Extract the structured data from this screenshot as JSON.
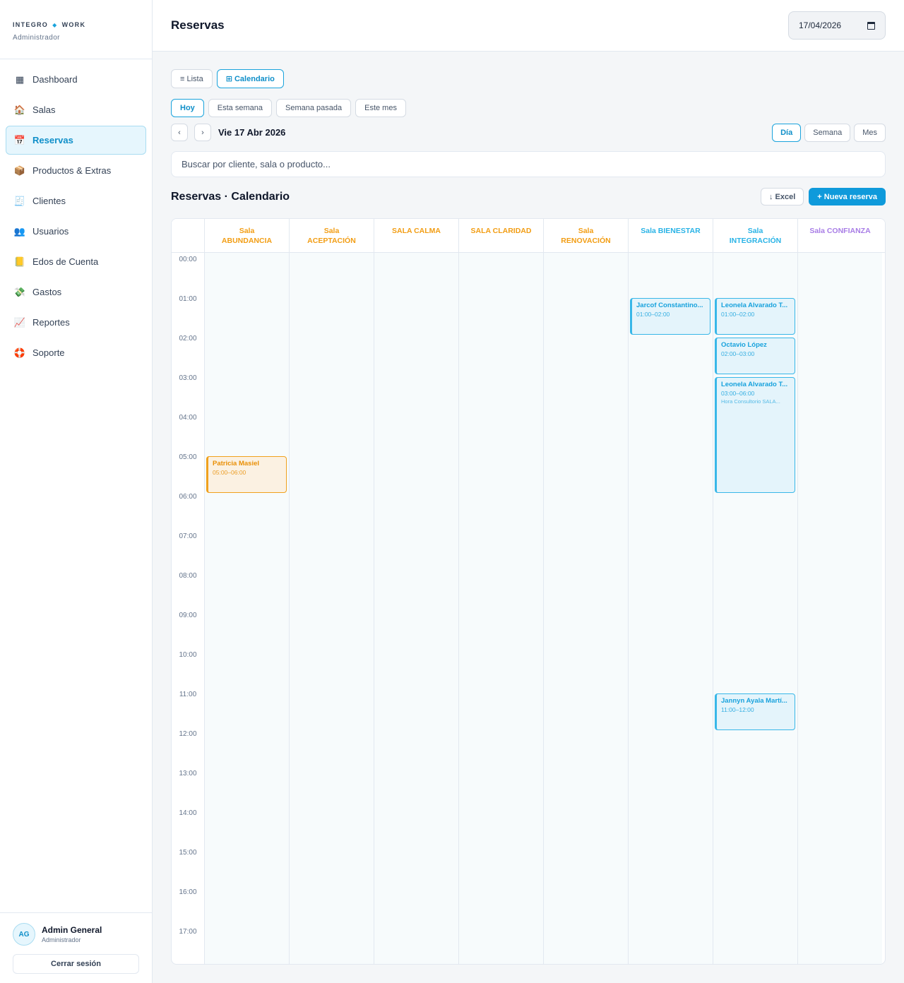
{
  "brand": {
    "left": "INTEGRO",
    "right": "WORK",
    "role": "Administrador"
  },
  "nav": [
    {
      "label": "Dashboard",
      "icon": "dashboard-icon",
      "glyph": "▦",
      "active": false
    },
    {
      "label": "Salas",
      "icon": "house-icon",
      "glyph": "🏠",
      "active": false
    },
    {
      "label": "Reservas",
      "icon": "calendar-icon",
      "glyph": "📅",
      "active": true
    },
    {
      "label": "Productos & Extras",
      "icon": "package-icon",
      "glyph": "📦",
      "active": false
    },
    {
      "label": "Clientes",
      "icon": "receipt-icon",
      "glyph": "🧾",
      "active": false
    },
    {
      "label": "Usuarios",
      "icon": "users-icon",
      "glyph": "👥",
      "active": false
    },
    {
      "label": "Edos de Cuenta",
      "icon": "ledger-icon",
      "glyph": "📒",
      "active": false
    },
    {
      "label": "Gastos",
      "icon": "money-icon",
      "glyph": "💸",
      "active": false
    },
    {
      "label": "Reportes",
      "icon": "chart-icon",
      "glyph": "📈",
      "active": false
    },
    {
      "label": "Soporte",
      "icon": "lifebuoy-icon",
      "glyph": "🛟",
      "active": false
    }
  ],
  "user": {
    "initials": "AG",
    "name": "Admin General",
    "role": "Administrador",
    "logout": "Cerrar sesión"
  },
  "header": {
    "title": "Reservas",
    "date": "17/04/2026"
  },
  "view_toggle": {
    "list": "≡ Lista",
    "calendar": "⊞ Calendario"
  },
  "ranges": [
    "Hoy",
    "Esta semana",
    "Semana pasada",
    "Este mes"
  ],
  "date_nav": {
    "prev": "‹",
    "next": "›",
    "current": "Vie 17 Abr 2026"
  },
  "span_toggle": [
    "Día",
    "Semana",
    "Mes"
  ],
  "search": {
    "placeholder": "Buscar por cliente, sala o producto..."
  },
  "section": {
    "title": "Reservas · Calendario",
    "excel": "↓ Excel",
    "new": "+ Nueva reserva"
  },
  "colors": {
    "orange": "#f29d13",
    "blue": "#29b3e6",
    "purple": "#a87de6"
  },
  "rooms": [
    {
      "line1": "Sala",
      "line2": "ABUNDANCIA",
      "color": "#f29d13"
    },
    {
      "line1": "Sala",
      "line2": "ACEPTACIÓN",
      "color": "#f29d13"
    },
    {
      "line1": "SALA CALMA",
      "line2": "",
      "color": "#f29d13"
    },
    {
      "line1": "SALA CLARIDAD",
      "line2": "",
      "color": "#f29d13"
    },
    {
      "line1": "Sala",
      "line2": "RENOVACIÓN",
      "color": "#f29d13"
    },
    {
      "line1": "Sala BIENESTAR",
      "line2": "",
      "color": "#29b3e6"
    },
    {
      "line1": "Sala",
      "line2": "INTEGRACIÓN",
      "color": "#29b3e6"
    },
    {
      "line1": "Sala CONFIANZA",
      "line2": "",
      "color": "#a87de6"
    }
  ],
  "hours": [
    "00:00",
    "01:00",
    "02:00",
    "03:00",
    "04:00",
    "05:00",
    "06:00",
    "07:00",
    "08:00",
    "09:00",
    "10:00",
    "11:00",
    "12:00",
    "13:00",
    "14:00",
    "15:00",
    "16:00",
    "17:00"
  ],
  "events": [
    {
      "room": 0,
      "start": 5,
      "end": 6,
      "title": "Patricia Masiel",
      "time": "05:00–06:00",
      "note": "",
      "style": "orange"
    },
    {
      "room": 5,
      "start": 1,
      "end": 2,
      "title": "Jarcof Constantino...",
      "time": "01:00–02:00",
      "note": "",
      "style": "blue"
    },
    {
      "room": 6,
      "start": 1,
      "end": 2,
      "title": "Leonela Alvarado T...",
      "time": "01:00–02:00",
      "note": "",
      "style": "blue"
    },
    {
      "room": 6,
      "start": 2,
      "end": 3,
      "title": "Octavio López",
      "time": "02:00–03:00",
      "note": "",
      "style": "blue"
    },
    {
      "room": 6,
      "start": 3,
      "end": 6,
      "title": "Leonela Alvarado T...",
      "time": "03:00–06:00",
      "note": "Hora Consultorio SALA...",
      "style": "blue"
    },
    {
      "room": 6,
      "start": 11,
      "end": 12,
      "title": "Jannyn Ayala Martí...",
      "time": "11:00–12:00",
      "note": "",
      "style": "blue"
    }
  ]
}
